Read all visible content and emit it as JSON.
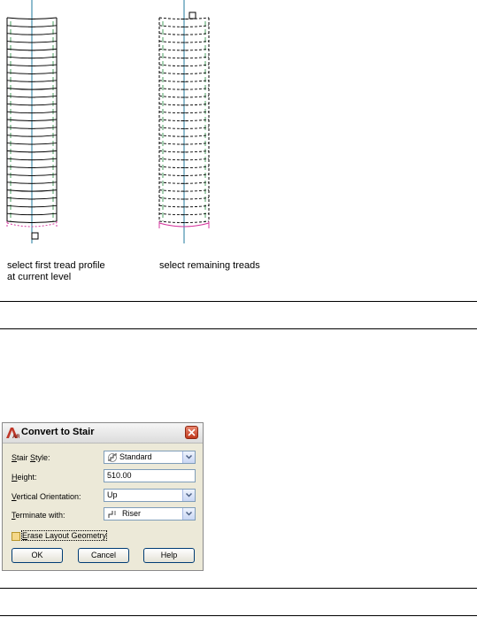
{
  "captions": {
    "left": [
      "select first tread profile",
      "at current level"
    ],
    "right": "select remaining treads"
  },
  "dialog": {
    "title": "Convert to Stair",
    "logo_text": "AR",
    "fields": [
      {
        "label_access": "S",
        "label_rest": "tair ",
        "label_second_access": "S",
        "label_tail": "tyle:",
        "value": "Standard",
        "icon": "stair-style-icon"
      },
      {
        "label_access": "H",
        "label_rest": "eight:",
        "value": "510.00"
      },
      {
        "label_access": "V",
        "label_rest": "ertical Orientation:",
        "value": "Up"
      },
      {
        "label_access": "T",
        "label_rest": "erminate with:",
        "value": "Riser",
        "icon": "riser-icon"
      }
    ],
    "checkbox": {
      "access": "E",
      "rest": "rase Layout Geometry",
      "checked": false
    },
    "buttons": {
      "ok": "OK",
      "cancel": "Cancel",
      "help": "Help"
    }
  },
  "colors": {
    "tread_line": "#000000",
    "axis": "#1f7a9c",
    "highlight": "#d63aa0",
    "riser": "#1f8a3a",
    "dialog_bg": "#ece9d8"
  }
}
